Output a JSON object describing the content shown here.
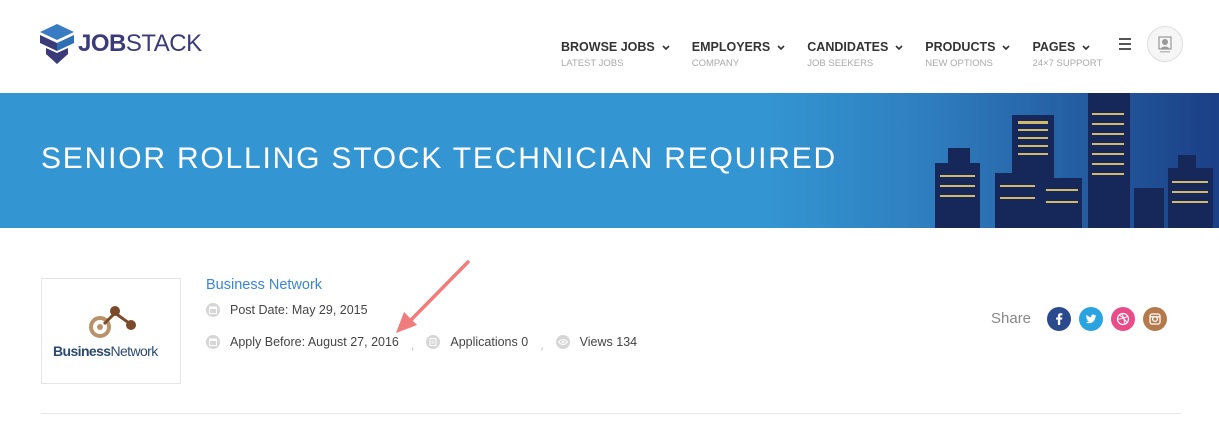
{
  "header": {
    "logo": {
      "bold": "JOB",
      "regular": "STACK"
    },
    "nav": [
      {
        "label": "BROWSE JOBS",
        "sub": "LATEST JOBS"
      },
      {
        "label": "EMPLOYERS",
        "sub": "COMPANY"
      },
      {
        "label": "CANDIDATES",
        "sub": "JOB SEEKERS"
      },
      {
        "label": "PRODUCTS",
        "sub": "NEW OPTIONS"
      },
      {
        "label": "PAGES",
        "sub": "24×7 SUPPORT"
      }
    ],
    "menu_icon": "hamburger-icon",
    "avatar": "user-avatar"
  },
  "banner": {
    "title": "SENIOR ROLLING STOCK TECHNICIAN REQUIRED"
  },
  "job": {
    "company_logo": {
      "bold": "Business",
      "regular": "Network"
    },
    "company_name": "Business Network",
    "post_date": "Post Date: May 29, 2015",
    "apply_before": "Apply Before: August 27, 2016",
    "applications": "Applications 0",
    "views": "Views 134",
    "separator": ","
  },
  "share": {
    "label": "Share",
    "icons": [
      {
        "name": "facebook-icon",
        "color": "#2b4a8e"
      },
      {
        "name": "twitter-icon",
        "color": "#2aa3e0"
      },
      {
        "name": "dribbble-icon",
        "color": "#ea4c89"
      },
      {
        "name": "instagram-icon",
        "color": "#b57a4c"
      }
    ]
  },
  "colors": {
    "accent": "#3396d2",
    "link": "#3a87d0",
    "annotation_arrow": "#f07c7c"
  }
}
